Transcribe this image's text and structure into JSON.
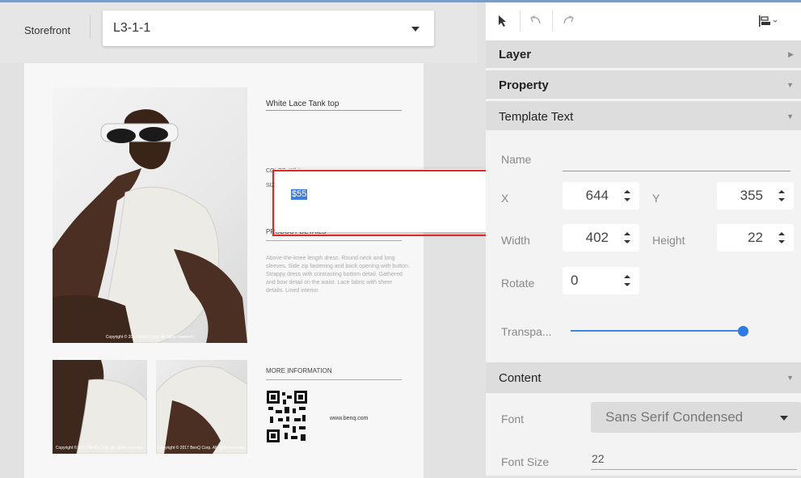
{
  "topbar": {
    "storefront_label": "Storefront",
    "layout_select": {
      "value": "L3-1-1"
    }
  },
  "canvas": {
    "product_title": "White Lace Tank top",
    "price_value": "$55",
    "color_line": "COLOR: White",
    "size_line": "SIZE: S M L XL",
    "details_title": "PRODUCT DETAILS",
    "details_text": "Above-the-knee length dress. Round neck and long sleeves. Side zip fastening and back opening with button. Strappy dress with contrasting bottom detail. Gathered and bow detail on the waist. Lace fabric with sheer details. Lined interior.",
    "more_title": "MORE INFORMATION",
    "website": "www.benq.com",
    "copyright": "Copyright © 2017 BenQ Corp. All rights reserved."
  },
  "panel": {
    "sections": {
      "layer": "Layer",
      "property": "Property",
      "template_text": "Template Text",
      "content": "Content"
    },
    "fields": {
      "name_label": "Name",
      "x_label": "X",
      "x_value": "644",
      "y_label": "Y",
      "y_value": "355",
      "width_label": "Width",
      "width_value": "402",
      "height_label": "Height",
      "height_value": "22",
      "rotate_label": "Rotate",
      "rotate_value": "0",
      "transparency_label": "Transpa...",
      "transparency_level": 1.0,
      "font_label": "Font",
      "font_value": "Sans Serif Condensed",
      "font_size_label": "Font Size",
      "font_size_value": "22"
    }
  },
  "colors": {
    "accent": "#2d7be0",
    "highlight_border": "#e12626",
    "selection": "#3d7ed8"
  }
}
